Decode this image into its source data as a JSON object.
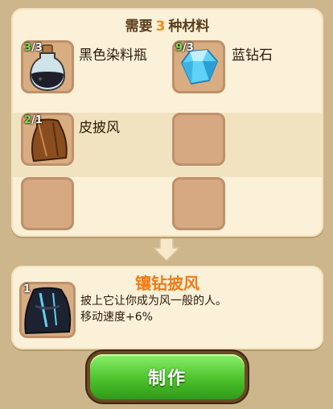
{
  "requirement": {
    "prefix": "需要",
    "count": "3",
    "suffix": "种材料"
  },
  "materials": [
    {
      "name": "黑色染料瓶",
      "have": "3",
      "need": "/3",
      "icon": "dye-bottle-icon"
    },
    {
      "name": "蓝钻石",
      "have": "9",
      "need": "/3",
      "icon": "blue-diamond-icon"
    },
    {
      "name": "皮披风",
      "have": "2",
      "need": "/1",
      "icon": "leather-cloak-icon"
    }
  ],
  "result": {
    "name": "镶钻披风",
    "count": "1",
    "description_line1": "披上它让你成为风一般的人。",
    "description_line2": "移动速度+6%",
    "icon": "diamond-cloak-icon"
  },
  "craft_button": {
    "label": "制作"
  },
  "colors": {
    "accent_orange": "#f28a18",
    "button_green": "#4dc12c",
    "count_green": "#7ee04a"
  }
}
